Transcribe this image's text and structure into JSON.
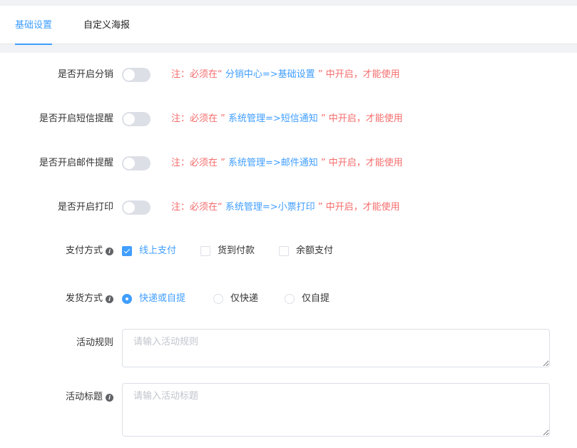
{
  "tabs": [
    {
      "label": "基础设置",
      "active": true
    },
    {
      "label": "自定义海报",
      "active": false
    }
  ],
  "form": {
    "distribution": {
      "label": "是否开启分销",
      "enabled": false,
      "note_prefix": "注：必须在“",
      "note_link": " 分销中心=>基础设置 ",
      "note_suffix": "” 中开启，才能使用"
    },
    "sms": {
      "label": "是否开启短信提醒",
      "enabled": false,
      "note_prefix": "注：必须在 ”",
      "note_link": " 系统管理=>短信通知 ",
      "note_suffix": "” 中开启，才能使用"
    },
    "email": {
      "label": "是否开启邮件提醒",
      "enabled": false,
      "note_prefix": "注：必须在 ”",
      "note_link": " 系统管理=>邮件通知 ",
      "note_suffix": "” 中开启，才能使用"
    },
    "print": {
      "label": "是否开启打印",
      "enabled": false,
      "note_prefix": "注：必须在“",
      "note_link": " 系统管理=>小票打印 ",
      "note_suffix": "” 中开启，才能使用"
    },
    "payment": {
      "label": "支付方式",
      "options": [
        {
          "label": "线上支付",
          "checked": true
        },
        {
          "label": "货到付款",
          "checked": false
        },
        {
          "label": "余额支付",
          "checked": false
        }
      ]
    },
    "delivery": {
      "label": "发货方式",
      "options": [
        {
          "label": "快递或自提",
          "checked": true
        },
        {
          "label": "仅快递",
          "checked": false
        },
        {
          "label": "仅自提",
          "checked": false
        }
      ]
    },
    "rules": {
      "label": "活动规则",
      "value": "",
      "placeholder": "请输入活动规则"
    },
    "title": {
      "label": "活动标题",
      "value": "",
      "placeholder": "请输入活动标题"
    }
  },
  "colors": {
    "accent": "#409eff",
    "danger": "#f56c6c"
  },
  "icons": {
    "info": "info-circle-icon"
  }
}
